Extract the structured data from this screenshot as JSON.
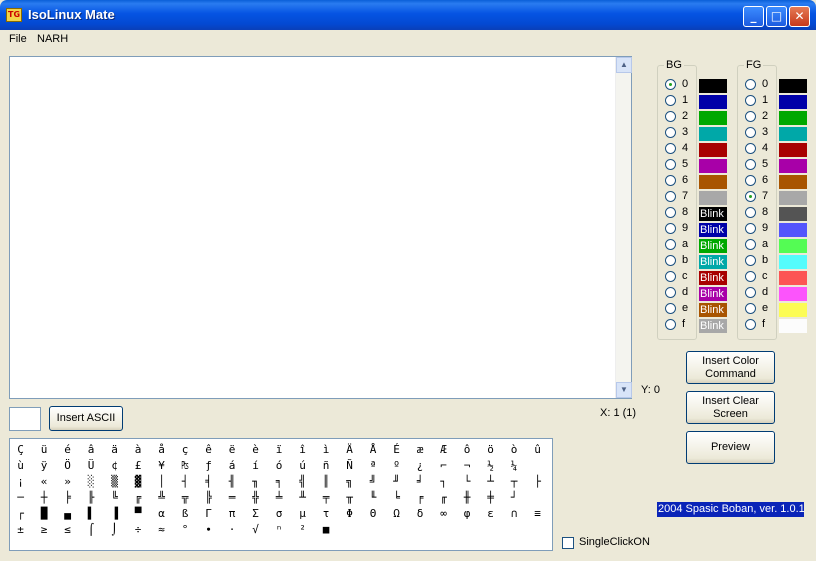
{
  "window": {
    "title": "IsoLinux Mate",
    "icon_label": "TG",
    "controls": {
      "minimize": "_",
      "maximize": "□",
      "close": "✕"
    }
  },
  "menu": {
    "items": [
      {
        "label": "File"
      },
      {
        "label": "NARH"
      }
    ]
  },
  "ascii_input": {
    "value": "",
    "button_label": "Insert ASCII"
  },
  "position": {
    "y_label": "Y: 0",
    "x_label": "X: 1 (1)"
  },
  "buttons": {
    "insert_color": "Insert Color Command",
    "insert_clear": "Insert Clear Screen",
    "preview": "Preview"
  },
  "bg": {
    "label": "BG",
    "selected": "0",
    "options": [
      {
        "label": "0",
        "color": "#000000",
        "text": ""
      },
      {
        "label": "1",
        "color": "#0000a8",
        "text": ""
      },
      {
        "label": "2",
        "color": "#00a800",
        "text": ""
      },
      {
        "label": "3",
        "color": "#00a8a8",
        "text": ""
      },
      {
        "label": "4",
        "color": "#a80000",
        "text": ""
      },
      {
        "label": "5",
        "color": "#a800a8",
        "text": ""
      },
      {
        "label": "6",
        "color": "#a85400",
        "text": ""
      },
      {
        "label": "7",
        "color": "#a8a8a8",
        "text": ""
      },
      {
        "label": "8",
        "color": "#000000",
        "text": "Blink"
      },
      {
        "label": "9",
        "color": "#0000a8",
        "text": "Blink"
      },
      {
        "label": "a",
        "color": "#00a800",
        "text": "Blink"
      },
      {
        "label": "b",
        "color": "#00a8a8",
        "text": "Blink"
      },
      {
        "label": "c",
        "color": "#a80000",
        "text": "Blink"
      },
      {
        "label": "d",
        "color": "#a800a8",
        "text": "Blink"
      },
      {
        "label": "e",
        "color": "#a85400",
        "text": "Blink"
      },
      {
        "label": "f",
        "color": "#a8a8a8",
        "text": "Blink"
      }
    ]
  },
  "fg": {
    "label": "FG",
    "selected": "7",
    "options": [
      {
        "label": "0",
        "color": "#000000"
      },
      {
        "label": "1",
        "color": "#0000a8"
      },
      {
        "label": "2",
        "color": "#00a800"
      },
      {
        "label": "3",
        "color": "#00a8a8"
      },
      {
        "label": "4",
        "color": "#a80000"
      },
      {
        "label": "5",
        "color": "#a800a8"
      },
      {
        "label": "6",
        "color": "#a85400"
      },
      {
        "label": "7",
        "color": "#a8a8a8"
      },
      {
        "label": "8",
        "color": "#545454"
      },
      {
        "label": "9",
        "color": "#5454fc"
      },
      {
        "label": "a",
        "color": "#54fc54"
      },
      {
        "label": "b",
        "color": "#54fcfc"
      },
      {
        "label": "c",
        "color": "#fc5454"
      },
      {
        "label": "d",
        "color": "#fc54fc"
      },
      {
        "label": "e",
        "color": "#fcfc54"
      },
      {
        "label": "f",
        "color": "#fcfcfc"
      }
    ]
  },
  "charmap": {
    "rows": [
      [
        "Ç",
        "ü",
        "é",
        "â",
        "ä",
        "à",
        "å",
        "ç",
        "ê",
        "ë",
        "è",
        "ï",
        "î",
        "ì",
        "Ä",
        "Å",
        "É",
        "æ",
        "Æ",
        "ô",
        "ö",
        "ò",
        "û"
      ],
      [
        "ù",
        "ÿ",
        "Ö",
        "Ü",
        "¢",
        "£",
        "¥",
        "₧",
        "ƒ",
        "á",
        "í",
        "ó",
        "ú",
        "ñ",
        "Ñ",
        "ª",
        "º",
        "¿",
        "⌐",
        "¬",
        "½",
        "¼"
      ],
      [
        "¡",
        "«",
        "»",
        "░",
        "▒",
        "▓",
        "│",
        "┤",
        "╡",
        "╢",
        "╖",
        "╕",
        "╣",
        "║",
        "╗",
        "╝",
        "╜",
        "╛",
        "┐",
        "└",
        "┴",
        "┬",
        "├"
      ],
      [
        "─",
        "┼",
        "╞",
        "╟",
        "╚",
        "╔",
        "╩",
        "╦",
        "╠",
        "═",
        "╬",
        "╧",
        "╨",
        "╤",
        "╥",
        "╙",
        "╘",
        "╒",
        "╓",
        "╫",
        "╪",
        "┘"
      ],
      [
        "┌",
        "█",
        "▄",
        "▌",
        "▐",
        "▀",
        "α",
        "ß",
        "Γ",
        "π",
        "Σ",
        "σ",
        "µ",
        "τ",
        "Φ",
        "Θ",
        "Ω",
        "δ",
        "∞",
        "φ",
        "ε",
        "∩",
        "≡"
      ],
      [
        "±",
        "≥",
        "≤",
        "⌠",
        "⌡",
        "÷",
        "≈",
        "°",
        "∙",
        "·",
        "√",
        "ⁿ",
        "²",
        "■"
      ]
    ]
  },
  "single_click": {
    "label": "SingleClickON",
    "checked": false
  },
  "version": "2004 Spasic Boban,  ver. 1.0.1"
}
